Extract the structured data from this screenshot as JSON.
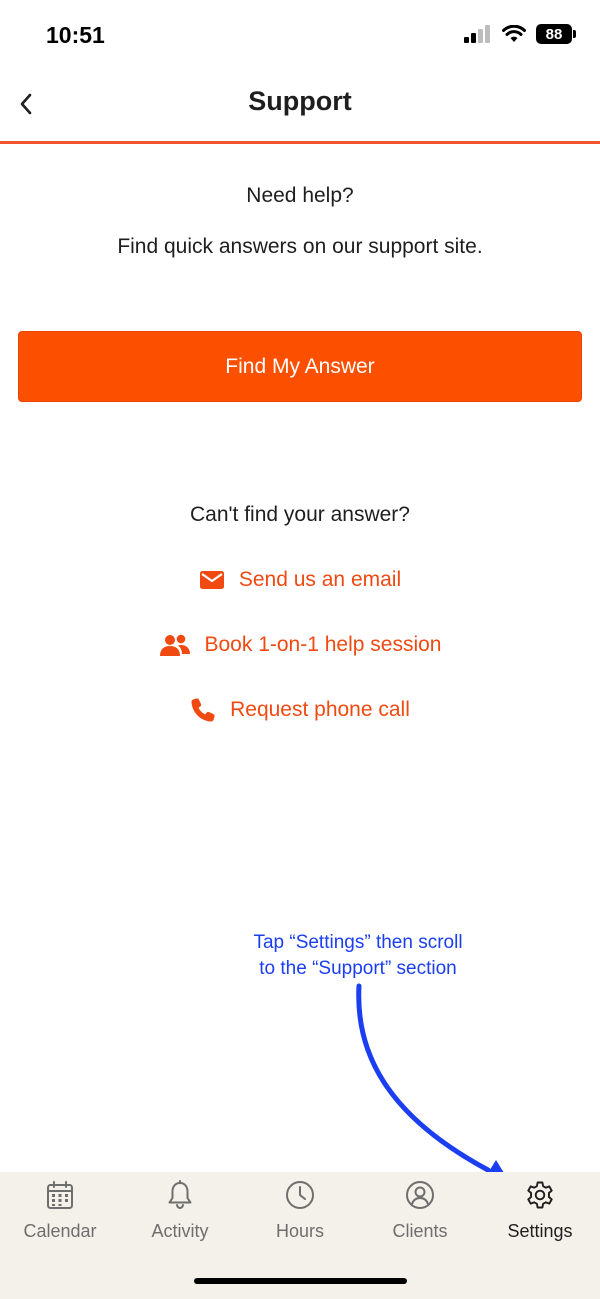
{
  "status_bar": {
    "time": "10:51",
    "battery": "88"
  },
  "header": {
    "title": "Support"
  },
  "help": {
    "heading": "Need help?",
    "subtext": "Find quick answers on our support site.",
    "primary_button": "Find My Answer"
  },
  "contact": {
    "heading": "Can't find your answer?",
    "options": [
      {
        "label": "Send us an email",
        "icon": "envelope-icon"
      },
      {
        "label": "Book 1-on-1 help session",
        "icon": "people-icon"
      },
      {
        "label": "Request phone call",
        "icon": "phone-icon"
      }
    ]
  },
  "annotation": {
    "line1": "Tap “Settings” then scroll",
    "line2": "to the “Support” section"
  },
  "tabs": [
    {
      "label": "Calendar",
      "icon": "calendar-icon"
    },
    {
      "label": "Activity",
      "icon": "bell-icon"
    },
    {
      "label": "Hours",
      "icon": "clock-icon"
    },
    {
      "label": "Clients",
      "icon": "user-circle-icon"
    },
    {
      "label": "Settings",
      "icon": "gear-icon",
      "active": true
    }
  ],
  "colors": {
    "accent": "#fd4f00",
    "link": "#f04a12",
    "annotation": "#1b3ef0",
    "tab_bar_bg": "#f4f1ea"
  }
}
